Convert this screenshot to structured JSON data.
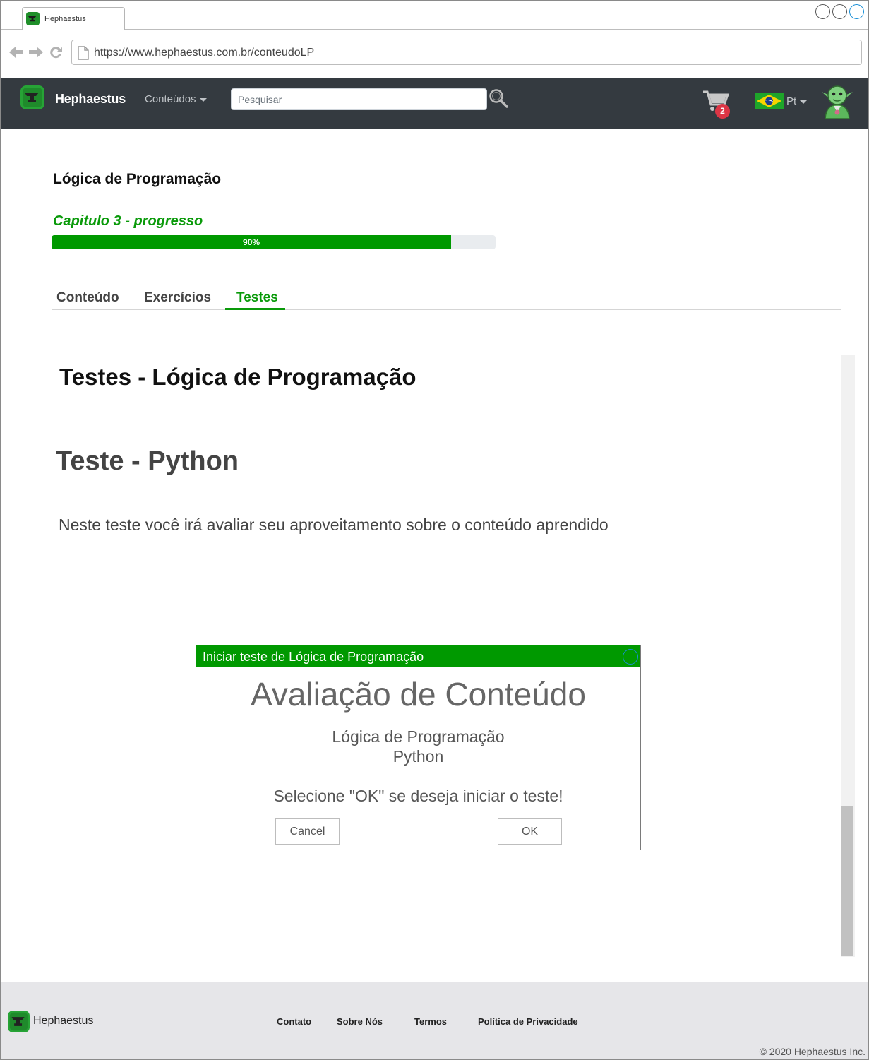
{
  "browser": {
    "tab_title": "Hephaestus",
    "url": "https://www.hephaestus.com.br/conteudoLP"
  },
  "navbar": {
    "brand": "Hephaestus",
    "menu_label": "Conteúdos",
    "search_placeholder": "Pesquisar",
    "cart_count": "2",
    "language": "Pt"
  },
  "course": {
    "title": "Lógica de Programação",
    "progress_label": "Capitulo 3 - progresso",
    "progress_percent": 90,
    "progress_text": "90%"
  },
  "tabs": [
    {
      "label": "Conteúdo",
      "active": false
    },
    {
      "label": "Exercícios",
      "active": false
    },
    {
      "label": "Testes",
      "active": true
    }
  ],
  "content": {
    "section_title": "Testes - Lógica de Programação",
    "test_title": "Teste - Python",
    "test_description": "Neste teste você irá avaliar seu aproveitamento sobre o conteúdo aprendido"
  },
  "modal": {
    "title": "Iniciar teste de Lógica de Programação",
    "heading": "Avaliação de Conteúdo",
    "line1": "Lógica de Programação",
    "line2": "Python",
    "prompt": "Selecione \"OK\" se deseja iniciar o teste!",
    "cancel_label": "Cancel",
    "ok_label": "OK"
  },
  "footer": {
    "brand": "Hephaestus",
    "links": [
      "Contato",
      "Sobre Nós",
      "Termos",
      "Política de Privacidade"
    ],
    "copyright": "© 2020 Hephaestus Inc."
  },
  "colors": {
    "accent_green": "#009900",
    "navbar_bg": "#343a40",
    "badge_red": "#dc3545"
  },
  "icons": [
    "back-arrow-icon",
    "forward-arrow-icon",
    "reload-icon",
    "page-icon",
    "search-icon",
    "cart-icon",
    "brazil-flag-icon",
    "user-avatar-icon",
    "anvil-logo-icon"
  ]
}
